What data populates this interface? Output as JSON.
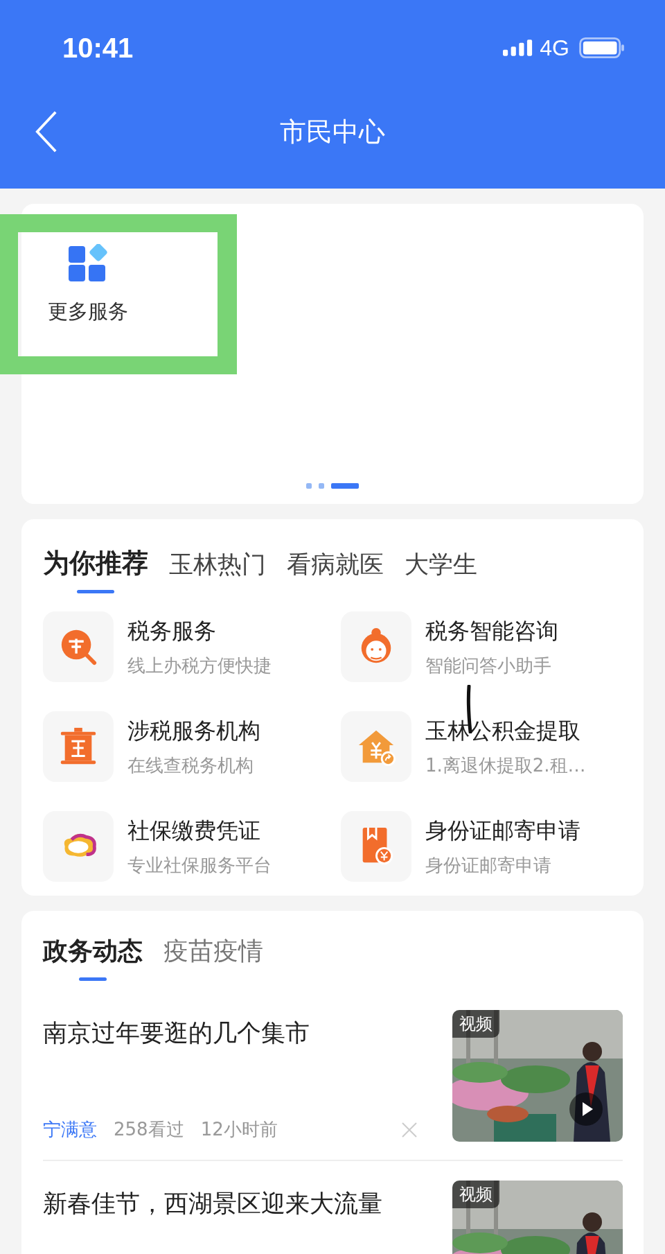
{
  "status_bar": {
    "time": "10:41",
    "network": "4G"
  },
  "nav": {
    "title": "市民中心"
  },
  "services_card": {
    "items": [
      {
        "label": "更多服务",
        "kind": "grid",
        "highlighted": true
      }
    ],
    "pager": [
      {
        "selected": false
      },
      {
        "selected": false
      },
      {
        "selected": true
      }
    ]
  },
  "recommend": {
    "tabs": [
      {
        "label": "为你推荐",
        "selected": true
      },
      {
        "label": "玉林热门",
        "selected": false
      },
      {
        "label": "看病就医",
        "selected": false
      },
      {
        "label": "大学生",
        "selected": false
      }
    ],
    "items": [
      {
        "title": "税务服务",
        "subtitle": "线上办税方便快捷",
        "kind": "tax-search"
      },
      {
        "title": "税务智能咨询",
        "subtitle": "智能问答小助手",
        "kind": "agent"
      },
      {
        "title": "涉税服务机构",
        "subtitle": "在线查税务机构",
        "kind": "building"
      },
      {
        "title": "玉林公积金提取",
        "subtitle": "1.离退休提取2.租…",
        "kind": "house-yen",
        "pen_mark": true
      },
      {
        "title": "社保缴费凭证",
        "subtitle": "专业社保服务平台",
        "kind": "cloud"
      },
      {
        "title": "身份证邮寄申请",
        "subtitle": "身份证邮寄申请",
        "kind": "book-yen"
      }
    ]
  },
  "news": {
    "tabs": [
      {
        "label": "政务动态",
        "selected": true
      },
      {
        "label": "疫苗疫情",
        "selected": false
      }
    ],
    "articles": [
      {
        "title": "南京过年要逛的几个集市",
        "source": "宁满意",
        "views": "258看过",
        "time": "12小时前",
        "badge": "视频",
        "video": true
      },
      {
        "title": "新春佳节，西湖景区迎来大流量",
        "badge": "视频",
        "video": false
      }
    ]
  }
}
